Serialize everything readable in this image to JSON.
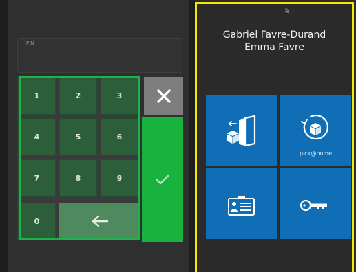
{
  "pin_field": {
    "label": "PIN"
  },
  "keypad": {
    "keys": [
      "1",
      "2",
      "3",
      "4",
      "5",
      "6",
      "7",
      "8",
      "9",
      "0"
    ],
    "backspace_icon": "arrow-left-icon",
    "clear_icon": "close-icon",
    "confirm_icon": "checkmark-icon"
  },
  "user": {
    "line1": "Gabriel Favre-Durand",
    "line2": "Emma Favre"
  },
  "tiles": [
    {
      "icon": "package-return-door-icon",
      "label": ""
    },
    {
      "icon": "pick-at-home-icon",
      "label": "pick@home"
    },
    {
      "icon": "id-card-icon",
      "label": ""
    },
    {
      "icon": "key-icon",
      "label": ""
    }
  ],
  "colors": {
    "keypad_key": "#2b5e39",
    "keypad_highlight": "#1ab44a",
    "confirm": "#18b23e",
    "clear": "#7e7e7e",
    "tile": "#0f6eb6",
    "selection_border": "#f3ea00"
  }
}
